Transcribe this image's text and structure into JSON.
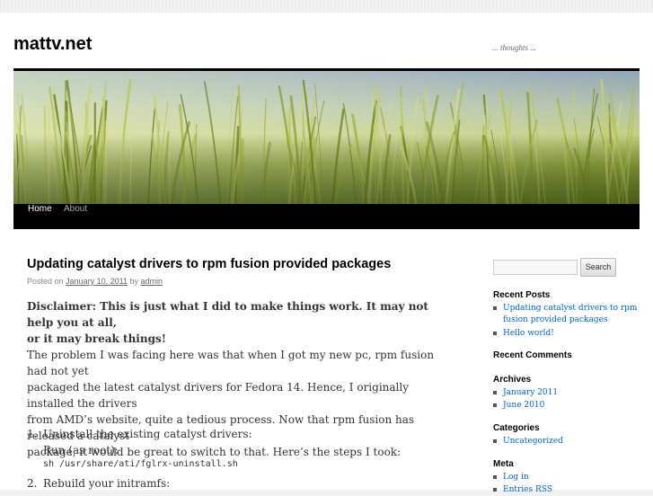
{
  "site": {
    "title": "mattv.net",
    "description": "... thoughts ..."
  },
  "nav": {
    "items": [
      {
        "label": "Home"
      },
      {
        "label": "About"
      }
    ]
  },
  "post": {
    "title": "Updating catalyst drivers to rpm fusion provided packages",
    "meta": {
      "posted_on": "Posted on",
      "date": "January 10, 2011",
      "by": "by",
      "author": "admin"
    },
    "disclaimer": [
      "Disclaimer: This is just what I did to make things work. It may not help you at all,",
      "or it may break things!"
    ],
    "paragraph": [
      "The problem I was facing here was that when I got my new pc, rpm fusion had not yet",
      "packaged the latest catalyst drivers for Fedora 14. Hence, I originally installed the drivers",
      "from AMD’s website, quite a tedious process. Now that rpm fusion has released a catalyst",
      "package, it would be great to switch to that. Here’s the steps I took:"
    ],
    "steps": [
      {
        "num": "1.",
        "text": "Uninstall the existing catalyst drivers:",
        "sub": "Run (as root):",
        "code": "sh /usr/share/ati/fglrx-uninstall.sh"
      },
      {
        "num": "2.",
        "text": "Rebuild your initramfs:"
      }
    ]
  },
  "sidebar": {
    "search_button": "Search",
    "recent_posts": {
      "title": "Recent Posts",
      "items": [
        [
          "Updating catalyst drivers to rpm",
          "fusion provided packages"
        ],
        [
          "Hello world!"
        ]
      ]
    },
    "recent_comments": {
      "title": "Recent Comments"
    },
    "archives": {
      "title": "Archives",
      "items": [
        "January 2011",
        "June 2010"
      ]
    },
    "categories": {
      "title": "Categories",
      "items": [
        "Uncategorized"
      ]
    },
    "meta": {
      "title": "Meta",
      "items": [
        "Log in",
        "Entries RSS"
      ]
    }
  }
}
